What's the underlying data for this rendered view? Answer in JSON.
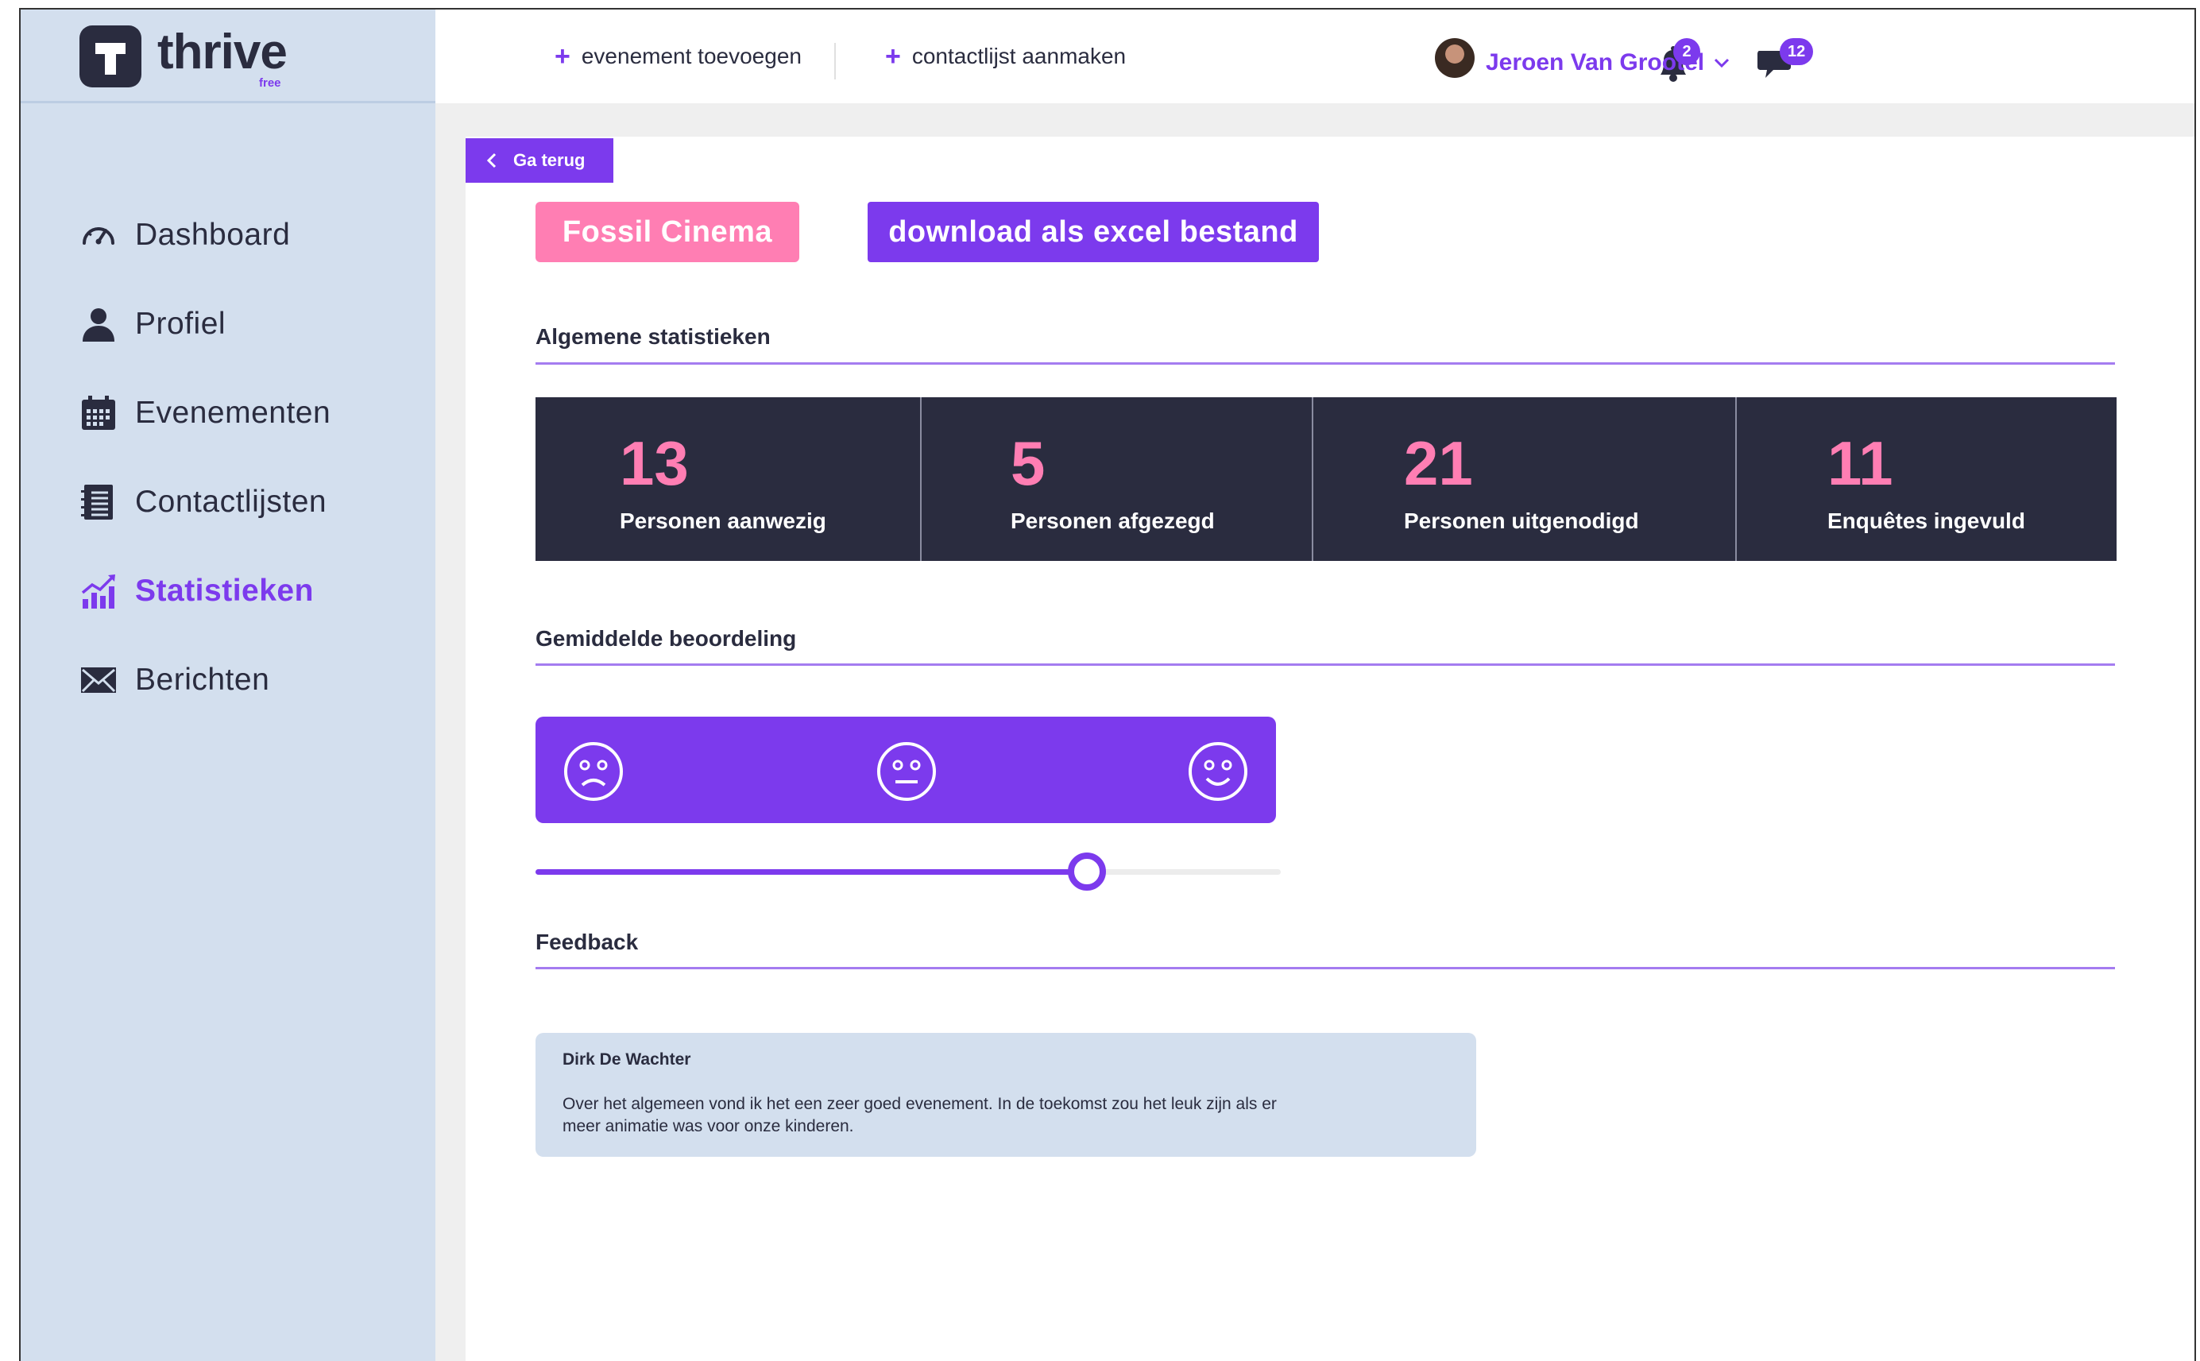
{
  "app": {
    "logo_text": "thrive",
    "logo_sub": "free",
    "logo_letter": "T"
  },
  "sidebar": {
    "items": [
      {
        "label": "Dashboard",
        "icon": "speedometer-icon",
        "active": false
      },
      {
        "label": "Profiel",
        "icon": "user-icon",
        "active": false
      },
      {
        "label": "Evenementen",
        "icon": "calendar-icon",
        "active": false
      },
      {
        "label": "Contactlijsten",
        "icon": "list-icon",
        "active": false
      },
      {
        "label": "Statistieken",
        "icon": "chart-icon",
        "active": true
      },
      {
        "label": "Berichten",
        "icon": "envelope-icon",
        "active": false
      }
    ]
  },
  "header": {
    "add_event": "evenement toevoegen",
    "add_contactlist": "contactlijst aanmaken",
    "notifications_count": "2",
    "messages_count": "12",
    "user_name": "Jeroen Van Grootel"
  },
  "page": {
    "back_label": "Ga terug",
    "event_name": "Fossil Cinema",
    "download_label": "download als excel bestand",
    "general_stats_title": "Algemene statistieken",
    "stats": [
      {
        "value": "13",
        "label": "Personen aanwezig"
      },
      {
        "value": "5",
        "label": "Personen afgezegd"
      },
      {
        "value": "21",
        "label": "Personen uitgenodigd"
      },
      {
        "value": "11",
        "label": "Enquêtes ingevuld"
      }
    ],
    "rating_title": "Gemiddelde beoordeling",
    "rating_faces": [
      "sad-face-icon",
      "neutral-face-icon",
      "happy-face-icon"
    ],
    "rating_level": 0.74,
    "feedback_title": "Feedback",
    "feedback": [
      {
        "author": "Dirk De Wachter",
        "text": "Over het algemeen vond ik het een zeer goed evenement. In de toekomst zou het leuk zijn als er meer animatie was voor onze kinderen."
      }
    ]
  },
  "colors": {
    "accent": "#7c3aed",
    "pink": "#ff7eb3",
    "dark": "#2a2c3f",
    "sidebar": "#d3dfee"
  }
}
